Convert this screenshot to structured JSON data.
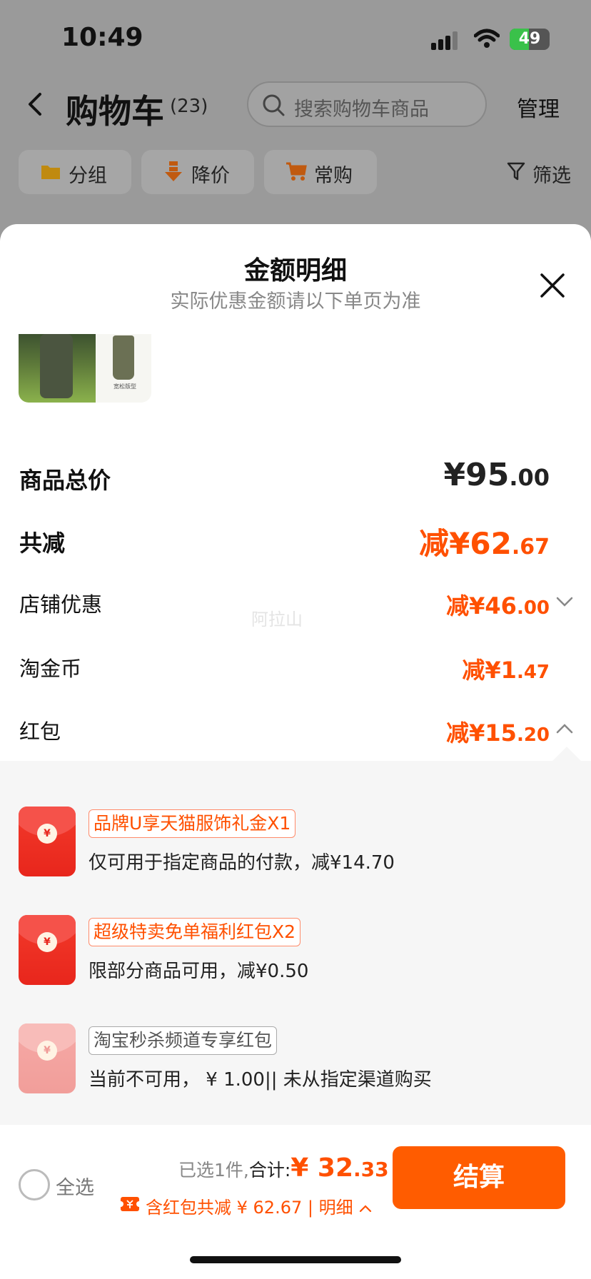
{
  "status_bar": {
    "time": "10:49",
    "battery": "49",
    "battery_level": 0.49
  },
  "nav": {
    "title": "购物车",
    "count": "(23)",
    "search_placeholder": "搜索购物车商品",
    "manage": "管理"
  },
  "chips": [
    {
      "icon": "folder-icon",
      "label": "分组"
    },
    {
      "icon": "price-down-icon",
      "label": "降价"
    },
    {
      "icon": "cart-icon",
      "label": "常购"
    }
  ],
  "filter": {
    "label": "筛选",
    "icon": "filter-icon"
  },
  "sheet": {
    "title": "金额明细",
    "subtitle": "实际优惠金额请以下单页为准",
    "thumb_caption": "宽松版型"
  },
  "rows": {
    "total": {
      "label": "商品总价",
      "symbol": "¥",
      "int": "95",
      "dec": ".00"
    },
    "discount": {
      "label": "共减",
      "prefix": "减",
      "symbol": "¥",
      "int": "62",
      "dec": ".67"
    },
    "shop": {
      "label": "店铺优惠",
      "prefix": "减",
      "symbol": "¥",
      "int": "46",
      "dec": ".00"
    },
    "coin": {
      "label": "淘金币",
      "prefix": "减",
      "symbol": "¥",
      "int": "1",
      "dec": ".47"
    },
    "redpacket": {
      "label": "红包",
      "prefix": "减",
      "symbol": "¥",
      "int": "15",
      "dec": ".20"
    }
  },
  "watermark": "阿拉山",
  "coupons": [
    {
      "tag": "品牌U享天猫服饰礼金X1",
      "desc": "仅可用于指定商品的付款，减¥14.70",
      "seal": "¥",
      "available": true
    },
    {
      "tag": "超级特卖免单福利红包X2",
      "desc": "限部分商品可用，减¥0.50",
      "seal": "¥",
      "available": true
    },
    {
      "tag": "淘宝秒杀频道专享红包",
      "desc": "当前不可用， ¥ 1.00|| 未从指定渠道购买",
      "seal": "¥",
      "available": false
    }
  ],
  "bottom": {
    "select_all": "全选",
    "selected": "已选1件,",
    "total_label": "合计:",
    "symbol": "¥ ",
    "int": "32",
    "dec": ".33",
    "red_line": "含红包共减 ¥ 62.67 | 明细",
    "checkout": "结算"
  },
  "colors": {
    "accent": "#ff5000",
    "checkout": "#ff5c00",
    "envelope": "#e8261c"
  }
}
